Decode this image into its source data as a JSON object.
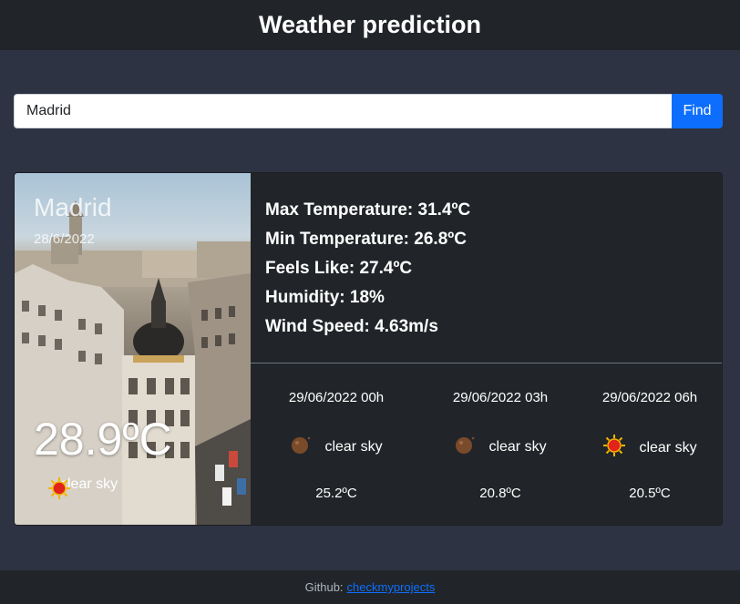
{
  "header": {
    "title": "Weather prediction"
  },
  "search": {
    "value": "Madrid",
    "button_label": "Find"
  },
  "current": {
    "city": "Madrid",
    "date": "28/6/2022",
    "temperature": "28.9ºC",
    "condition": "clear sky",
    "condition_icon": "sun-icon"
  },
  "stats": {
    "max_temp": "Max Temperature: 31.4ºC",
    "min_temp": "Min Temperature: 26.8ºC",
    "feels_like": "Feels Like: 27.4ºC",
    "humidity": "Humidity: 18%",
    "wind_speed": "Wind Speed: 4.63m/s"
  },
  "forecast": [
    {
      "datetime": "29/06/2022 00h",
      "condition": "clear sky",
      "icon": "moon-icon",
      "temp": "25.2ºC"
    },
    {
      "datetime": "29/06/2022 03h",
      "condition": "clear sky",
      "icon": "moon-icon",
      "temp": "20.8ºC"
    },
    {
      "datetime": "29/06/2022 06h",
      "condition": "clear sky",
      "icon": "sun-icon",
      "temp": "20.5ºC"
    }
  ],
  "footer": {
    "label": "Github:",
    "link_text": "checkmyprojects"
  },
  "colors": {
    "accent": "#0d6efd",
    "background": "#2d3343",
    "card": "#212529"
  }
}
